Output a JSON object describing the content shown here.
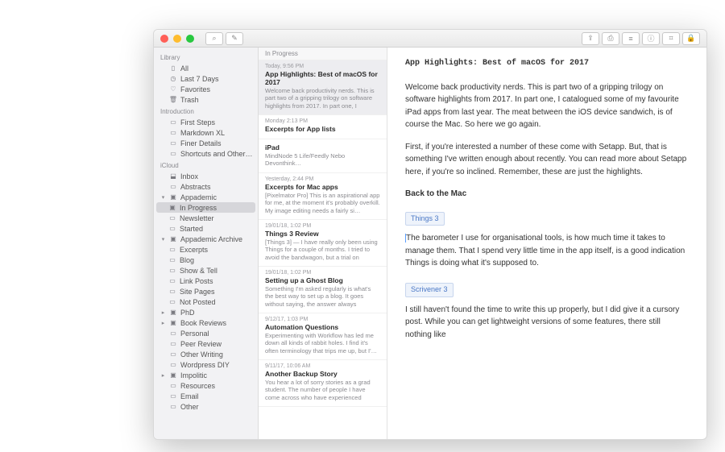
{
  "toolbar": {
    "left_icons": [
      "search-icon",
      "compose-icon"
    ],
    "right_icons": [
      "share-icon",
      "export-icon",
      "list-icon",
      "info-icon",
      "tag-icon",
      "lock-icon"
    ]
  },
  "sidebar": {
    "sections": [
      {
        "header": "Library",
        "items": [
          {
            "icon": "tray",
            "label": "All",
            "indent": 0
          },
          {
            "icon": "clock",
            "label": "Last 7 Days",
            "indent": 0
          },
          {
            "icon": "heart",
            "label": "Favorites",
            "indent": 0
          },
          {
            "icon": "trash",
            "label": "Trash",
            "indent": 0
          }
        ]
      },
      {
        "header": "Introduction",
        "items": [
          {
            "icon": "doc",
            "label": "First Steps",
            "indent": 0
          },
          {
            "icon": "doc",
            "label": "Markdown XL",
            "indent": 0
          },
          {
            "icon": "doc",
            "label": "Finer Details",
            "indent": 0
          },
          {
            "icon": "doc",
            "label": "Shortcuts and Other Ti…",
            "indent": 0
          }
        ]
      },
      {
        "header": "iCloud",
        "items": [
          {
            "icon": "inbox",
            "label": "Inbox",
            "indent": 0
          },
          {
            "icon": "doc",
            "label": "Abstracts",
            "indent": 0
          },
          {
            "icon": "folder",
            "label": "Appademic",
            "indent": 0,
            "disc": "▾",
            "selectedChild": true
          },
          {
            "icon": "folder",
            "label": "In Progress",
            "indent": 1,
            "selected": true
          },
          {
            "icon": "doc",
            "label": "Newsletter",
            "indent": 1
          },
          {
            "icon": "doc",
            "label": "Started",
            "indent": 1
          },
          {
            "icon": "folder",
            "label": "Appademic Archive",
            "indent": 0,
            "disc": "▾"
          },
          {
            "icon": "doc",
            "label": "Excerpts",
            "indent": 1
          },
          {
            "icon": "doc",
            "label": "Blog",
            "indent": 1
          },
          {
            "icon": "doc",
            "label": "Show & Tell",
            "indent": 1
          },
          {
            "icon": "doc",
            "label": "Link Posts",
            "indent": 1
          },
          {
            "icon": "doc",
            "label": "Site Pages",
            "indent": 1
          },
          {
            "icon": "doc",
            "label": "Not Posted",
            "indent": 1
          },
          {
            "icon": "folder",
            "label": "PhD",
            "indent": 0,
            "disc": "▸"
          },
          {
            "icon": "folder",
            "label": "Book Reviews",
            "indent": 0,
            "disc": "▸"
          },
          {
            "icon": "doc",
            "label": "Personal",
            "indent": 0
          },
          {
            "icon": "doc",
            "label": "Peer Review",
            "indent": 0
          },
          {
            "icon": "doc",
            "label": "Other Writing",
            "indent": 0
          },
          {
            "icon": "doc",
            "label": "Wordpress DIY",
            "indent": 0
          },
          {
            "icon": "folder",
            "label": "Impolitic",
            "indent": 0,
            "disc": "▸"
          },
          {
            "icon": "doc",
            "label": "Resources",
            "indent": 0
          },
          {
            "icon": "doc",
            "label": "Email",
            "indent": 0
          },
          {
            "icon": "doc",
            "label": "Other",
            "indent": 0
          }
        ]
      }
    ]
  },
  "notelist": {
    "header": "In Progress",
    "items": [
      {
        "date": "Today, 9:56 PM",
        "title": "App Highlights: Best of macOS for 2017",
        "preview": "Welcome back productivity nerds. This is part two of a gripping trilogy on software highlights from 2017. In part one, I catalo…",
        "selected": true
      },
      {
        "date": "Monday 2:13 PM",
        "title": "Excerpts for App lists",
        "preview": ""
      },
      {
        "date": "",
        "title": "iPad",
        "preview": "MindNode 5 Life/Feedly Nebo Devonthink…"
      },
      {
        "date": "Yesterday, 2:44 PM",
        "title": "Excerpts for Mac apps",
        "preview": "[Pixelmator Pro] This is an aspirational app for me, at the moment it's probably overkill. My image editing needs a fairly si…"
      },
      {
        "date": "19/01/18, 1:02 PM",
        "title": "Things 3 Review",
        "preview": "[Things 3] — I have really only been using Things for a couple of months. I tried to avoid the bandwagon, but a trial on macO…"
      },
      {
        "date": "19/01/18, 1:02 PM",
        "title": "Setting up a Ghost Blog",
        "preview": "Something I'm asked regularly is what's the best way to set up a blog. It goes without saying, the answer always depen…"
      },
      {
        "date": "9/12/17, 1:03 PM",
        "title": "Automation Questions",
        "preview": "Experimenting with Workflow has led me down all kinds of rabbit holes. I find it's often terminology that trips me up, but I'…"
      },
      {
        "date": "9/11/17, 10:06 AM",
        "title": "Another Backup Story",
        "preview": "You hear a lot of sorry stories as a grad student. The number of people I have come across who have experienced som…"
      }
    ]
  },
  "editor": {
    "title": "App Highlights: Best of macOS for 2017",
    "p1": "Welcome back productivity nerds. This is part two of a gripping trilogy on software highlights from 2017. In part one, I catalogued some of my favourite iPad apps from last year. The meat between the iOS device sandwich, is of course the Mac. So here we go again.",
    "p2": "First, if you're interested a number of these come with Setapp. But, that is something I've written enough about recently. You can read more about Setapp here, if you're so inclined. Remember, these are just the highlights.",
    "h2a": "Back to the Mac",
    "tag1": "Things 3",
    "p3": "The barometer I use for organisational tools, is how much time it takes to manage them. That I spend very little time in the app itself, is a good indication Things is doing what it's supposed to.",
    "tag2": "Scrivener 3",
    "p4": "I still haven't found the time to write this up properly, but I did give it a cursory post. While you can get lightweight versions of some features, there still nothing like"
  }
}
